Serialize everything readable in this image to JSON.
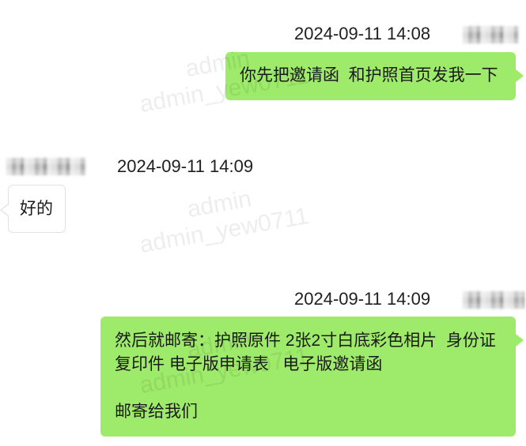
{
  "colors": {
    "background": "#ffffff",
    "outgoing_bubble": "#9eea6a",
    "incoming_bubble": "#ffffff"
  },
  "watermark": {
    "line1": "admin",
    "line2": "admin_yew0711"
  },
  "messages": [
    {
      "time": "2024-09-11 14:08",
      "lines": [
        "你先把邀请函  和护照首页发我一下"
      ]
    },
    {
      "time": "2024-09-11 14:09",
      "lines": [
        "好的"
      ]
    },
    {
      "time": "2024-09-11 14:09",
      "lines": [
        "然后就邮寄：护照原件 2张2寸白底彩色相片  身份证",
        "复印件 电子版申请表   电子版邀请函",
        "",
        "邮寄给我们"
      ]
    }
  ]
}
